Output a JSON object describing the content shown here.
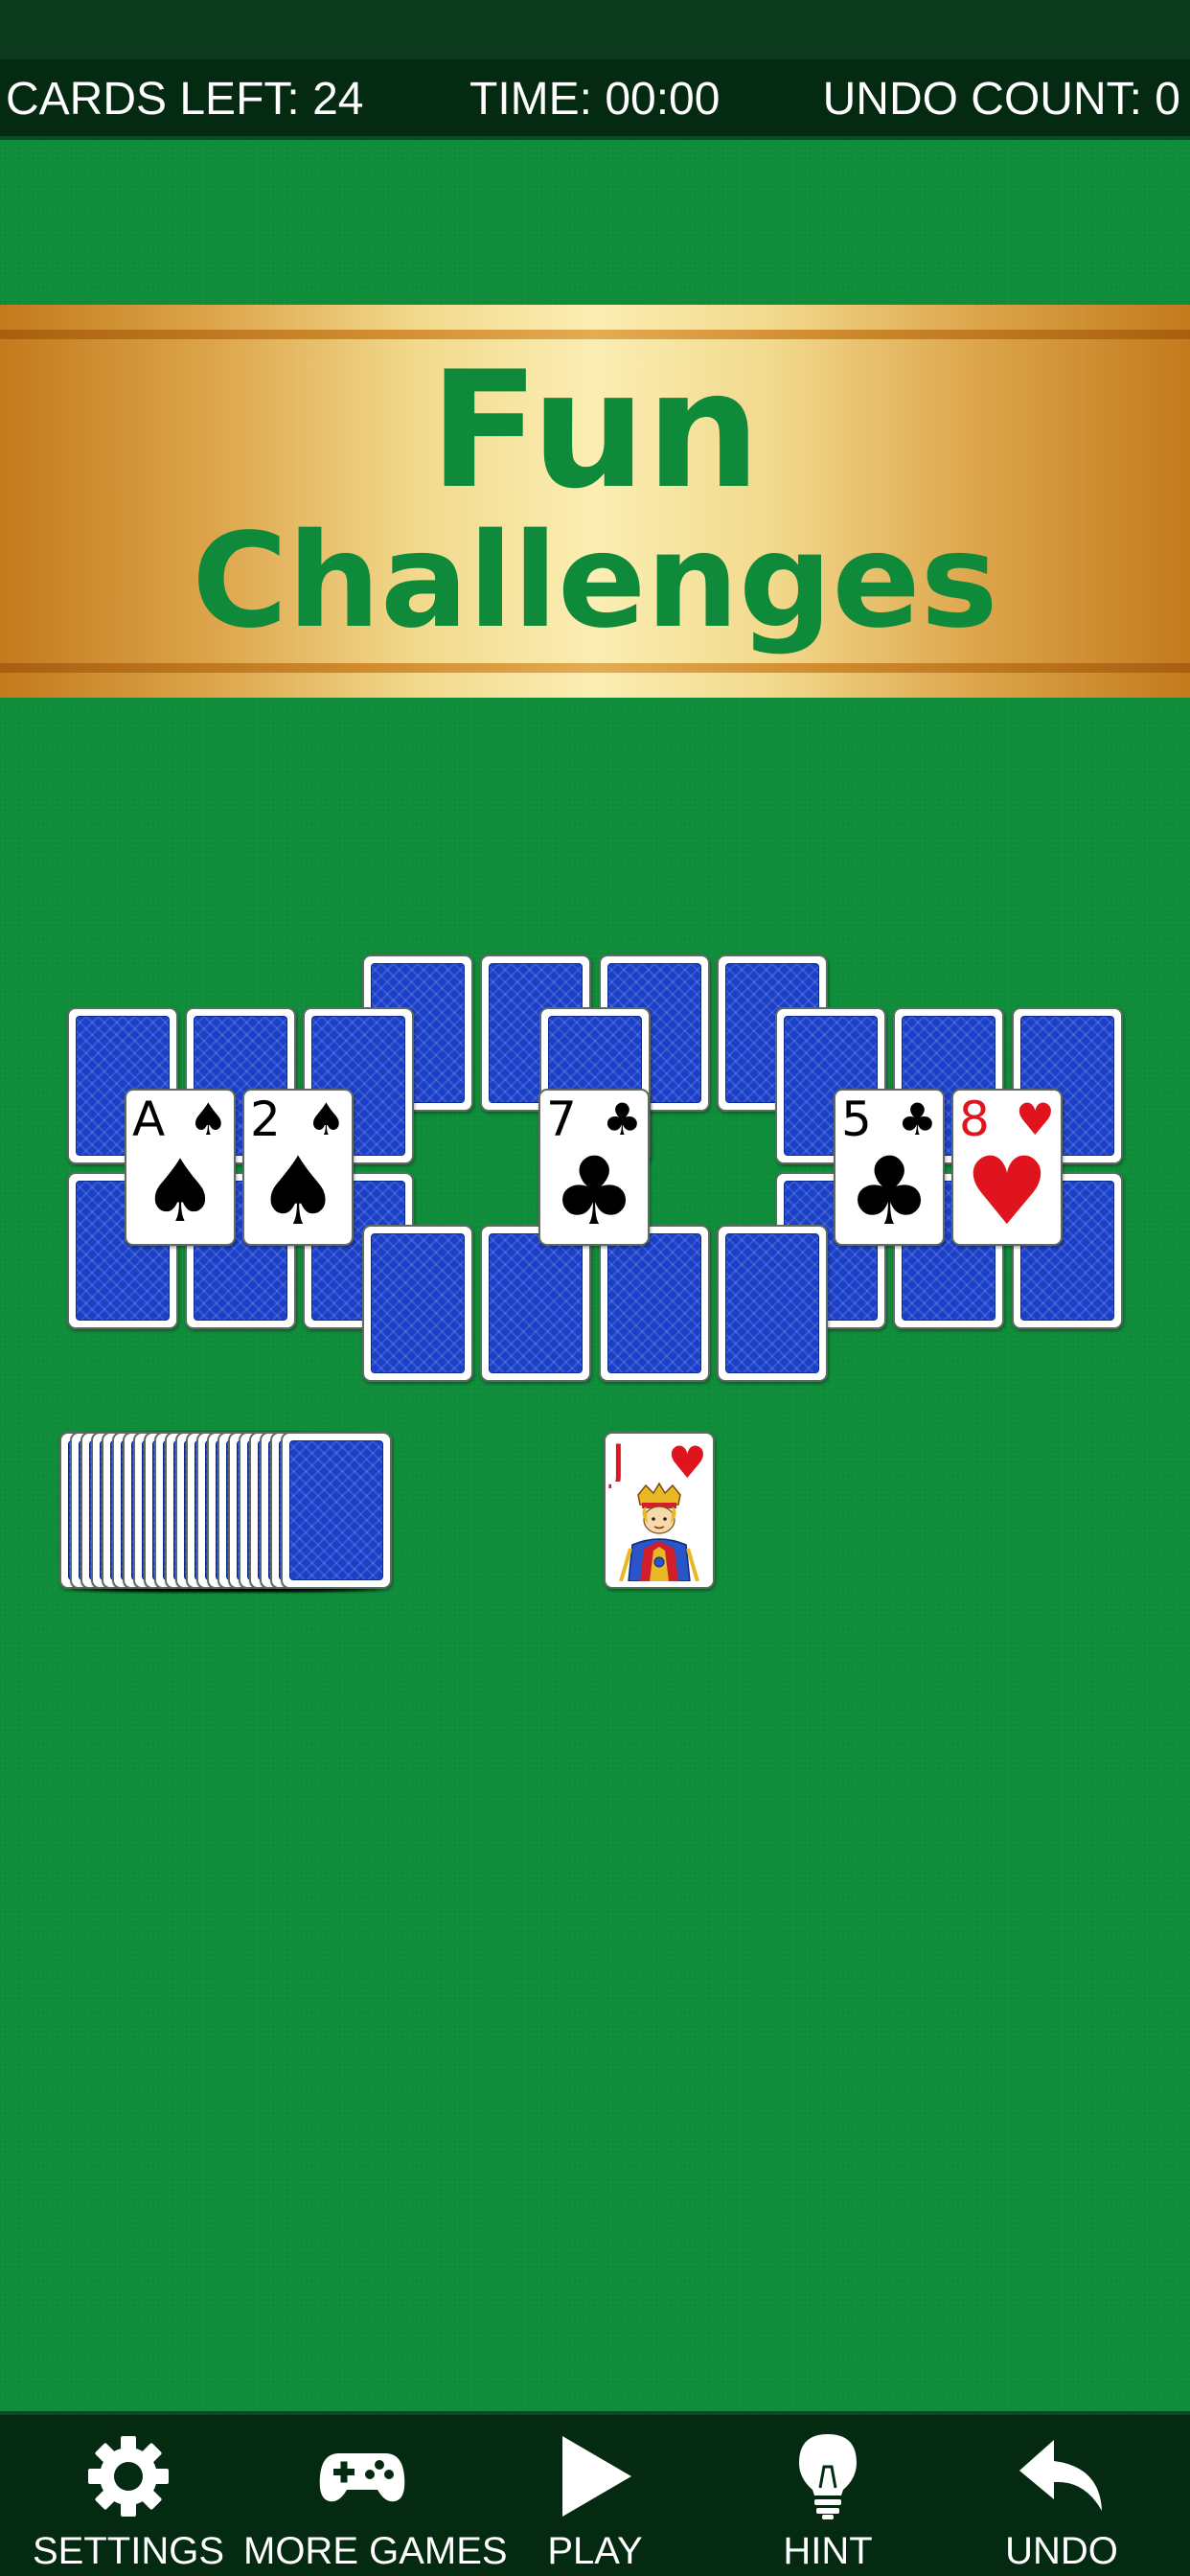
{
  "status": {
    "cards_left": "CARDS LEFT: 24",
    "time": "TIME: 00:00",
    "undo_count": "UNDO COUNT:  0"
  },
  "banner": {
    "line1": "Fun",
    "line2": "Challenges"
  },
  "tableau": {
    "face_up": [
      {
        "rank": "A",
        "suit": "♠",
        "color": "#000000"
      },
      {
        "rank": "2",
        "suit": "♠",
        "color": "#000000"
      },
      {
        "rank": "7",
        "suit": "♣",
        "color": "#000000"
      },
      {
        "rank": "5",
        "suit": "♣",
        "color": "#000000"
      },
      {
        "rank": "8",
        "suit": "♥",
        "color": "#e0141e"
      }
    ]
  },
  "waste": {
    "rank": "J",
    "suit": "♥",
    "color": "#e0141e"
  },
  "toolbar": {
    "settings": {
      "label": "SETTINGS",
      "icon": "gear-icon"
    },
    "more_games": {
      "label": "MORE GAMES",
      "icon": "gamepad-icon"
    },
    "play": {
      "label": "PLAY",
      "icon": "play-icon"
    },
    "hint": {
      "label": "HINT",
      "icon": "lightbulb-icon"
    },
    "undo": {
      "label": "UNDO",
      "icon": "undo-arrow-icon"
    }
  },
  "colors": {
    "felt": "#0f8d3a",
    "bar": "#052a12",
    "card_back": "#1a3fc8",
    "banner_text": "#0e8a3a"
  }
}
